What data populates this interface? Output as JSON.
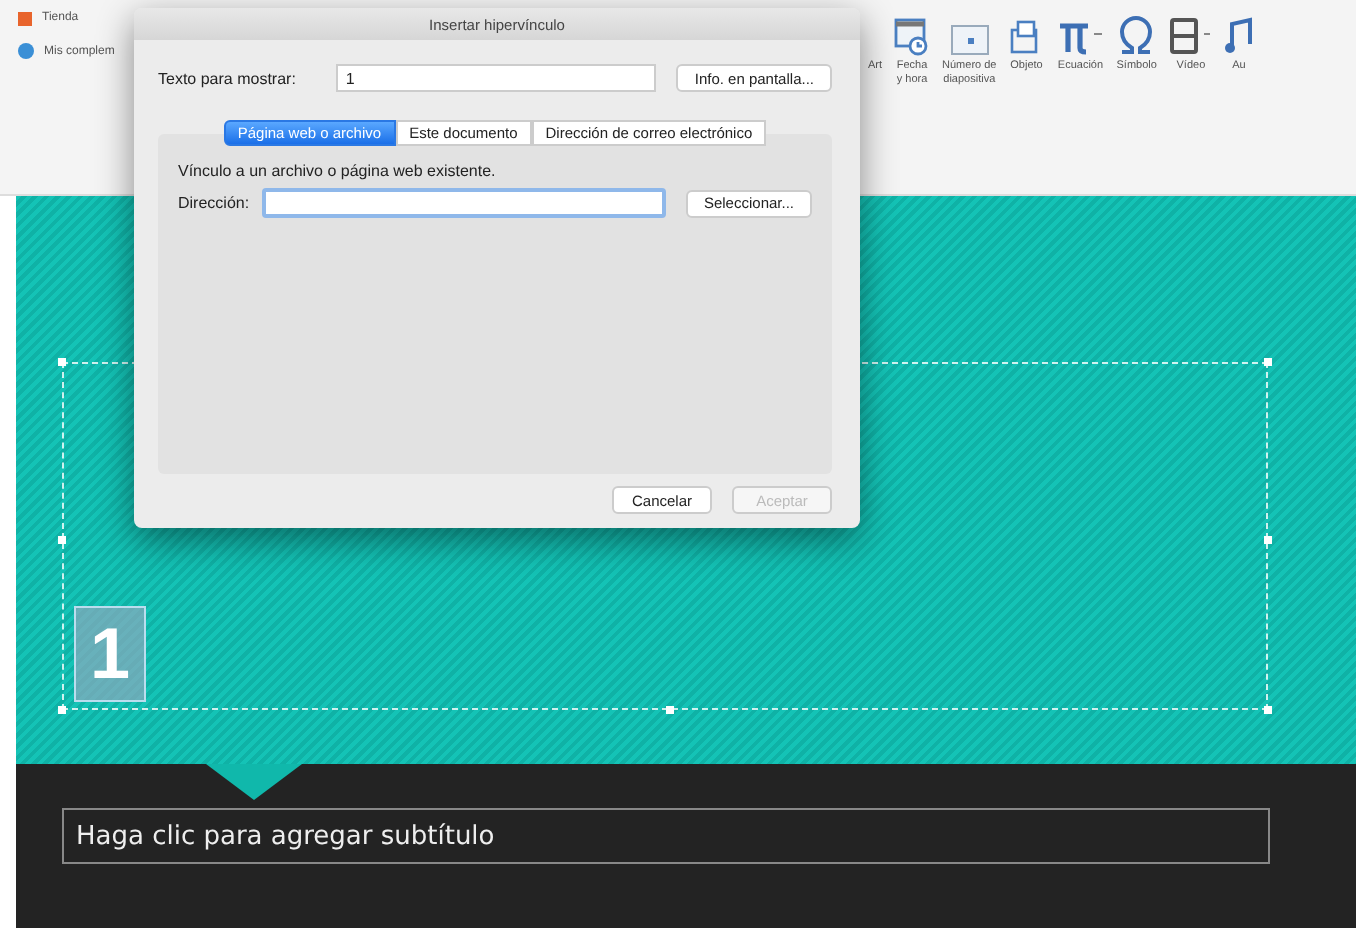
{
  "ribbon": {
    "left_items": [
      {
        "label": "Tienda",
        "kind": "store"
      },
      {
        "label": "Mis complem",
        "kind": "addins"
      }
    ],
    "right_items": [
      {
        "lines": [
          "Art"
        ],
        "kind": "none"
      },
      {
        "lines": [
          "Fecha",
          "y hora"
        ],
        "kind": "date"
      },
      {
        "lines": [
          "Número de",
          "diapositiva"
        ],
        "kind": "slide-number"
      },
      {
        "lines": [
          "Objeto"
        ],
        "kind": "object"
      },
      {
        "lines": [
          "Ecuación"
        ],
        "kind": "equation"
      },
      {
        "lines": [
          "Símbolo"
        ],
        "kind": "symbol"
      },
      {
        "lines": [
          "Vídeo"
        ],
        "kind": "video"
      },
      {
        "lines": [
          "Au"
        ],
        "kind": "audio"
      }
    ]
  },
  "slide": {
    "number": "1",
    "subtitle_placeholder": "Haga clic para agregar subtítulo"
  },
  "dialog": {
    "title": "Insertar hipervínculo",
    "display_text_label": "Texto para mostrar:",
    "display_text_value": "1",
    "screen_tip_button": "Info. en pantalla...",
    "tabs": [
      {
        "label": "Página web o archivo",
        "selected": true
      },
      {
        "label": "Este documento",
        "selected": false
      },
      {
        "label": "Dirección de correo electrónico",
        "selected": false
      }
    ],
    "description": "Vínculo a un archivo o página web existente.",
    "address_label": "Dirección:",
    "select_button": "Seleccionar...",
    "buttons": [
      {
        "label": "Cancelar",
        "disabled": false
      },
      {
        "label": "Aceptar",
        "disabled": true
      }
    ]
  }
}
